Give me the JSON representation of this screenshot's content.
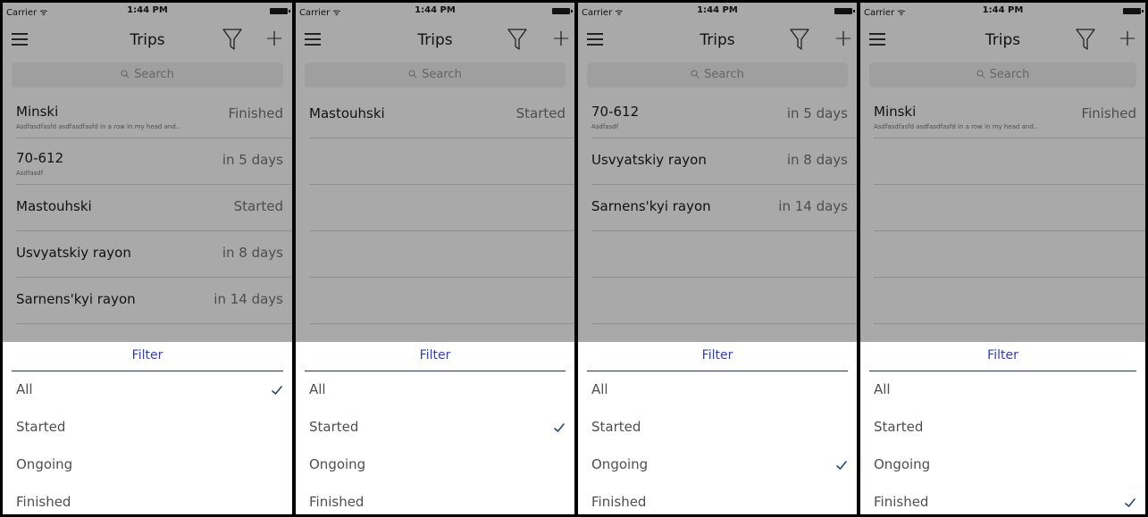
{
  "screens": [
    {
      "status": {
        "carrier": "Carrier ᯤ",
        "time": "1:44 PM"
      },
      "nav": {
        "title": "Trips",
        "add_label": "+"
      },
      "search": {
        "placeholder": "Search"
      },
      "trips": [
        {
          "title": "Minski",
          "subtitle": "Asdfasdfasfd asdfasdfasfd in a row in my head and..",
          "status": "Finished"
        },
        {
          "title": "70-612",
          "subtitle": "Asdfasdf",
          "status": "in 5 days"
        },
        {
          "title": "Mastouhski",
          "subtitle": "",
          "status": "Started"
        },
        {
          "title": "Usvyatskiy rayon",
          "subtitle": "",
          "status": "in 8 days"
        },
        {
          "title": "Sarnens'kyi rayon",
          "subtitle": "",
          "status": "in 14 days"
        }
      ],
      "filter": {
        "title": "Filter",
        "options": [
          "All",
          "Started",
          "Ongoing",
          "Finished"
        ],
        "selected": "All"
      }
    },
    {
      "status": {
        "carrier": "Carrier ᯤ",
        "time": "1:44 PM"
      },
      "nav": {
        "title": "Trips",
        "add_label": "+"
      },
      "search": {
        "placeholder": "Search"
      },
      "trips": [
        {
          "title": "Mastouhski",
          "subtitle": "",
          "status": "Started"
        }
      ],
      "filter": {
        "title": "Filter",
        "options": [
          "All",
          "Started",
          "Ongoing",
          "Finished"
        ],
        "selected": "Started"
      }
    },
    {
      "status": {
        "carrier": "Carrier ᯤ",
        "time": "1:44 PM"
      },
      "nav": {
        "title": "Trips",
        "add_label": "+"
      },
      "search": {
        "placeholder": "Search"
      },
      "trips": [
        {
          "title": "70-612",
          "subtitle": "Asdfasdf",
          "status": "in 5 days"
        },
        {
          "title": "Usvyatskiy rayon",
          "subtitle": "",
          "status": "in 8 days"
        },
        {
          "title": "Sarnens'kyi rayon",
          "subtitle": "",
          "status": "in 14 days"
        }
      ],
      "filter": {
        "title": "Filter",
        "options": [
          "All",
          "Started",
          "Ongoing",
          "Finished"
        ],
        "selected": "Ongoing"
      }
    },
    {
      "status": {
        "carrier": "Carrier ᯤ",
        "time": "1:44 PM"
      },
      "nav": {
        "title": "Trips",
        "add_label": "+"
      },
      "search": {
        "placeholder": "Search"
      },
      "trips": [
        {
          "title": "Minski",
          "subtitle": "Asdfasdfasfd asdfasdfasfd in a row in my head and..",
          "status": "Finished"
        }
      ],
      "filter": {
        "title": "Filter",
        "options": [
          "All",
          "Started",
          "Ongoing",
          "Finished"
        ],
        "selected": "Finished"
      }
    }
  ],
  "icons": {
    "menu": "hamburger-icon",
    "filter": "funnel-icon",
    "add": "plus-icon",
    "search": "magnifier-icon",
    "check": "checkmark-icon"
  },
  "colors": {
    "overlay": "#a9a9a9",
    "sheet_title": "#2f3bcf",
    "check": "#24486f"
  }
}
